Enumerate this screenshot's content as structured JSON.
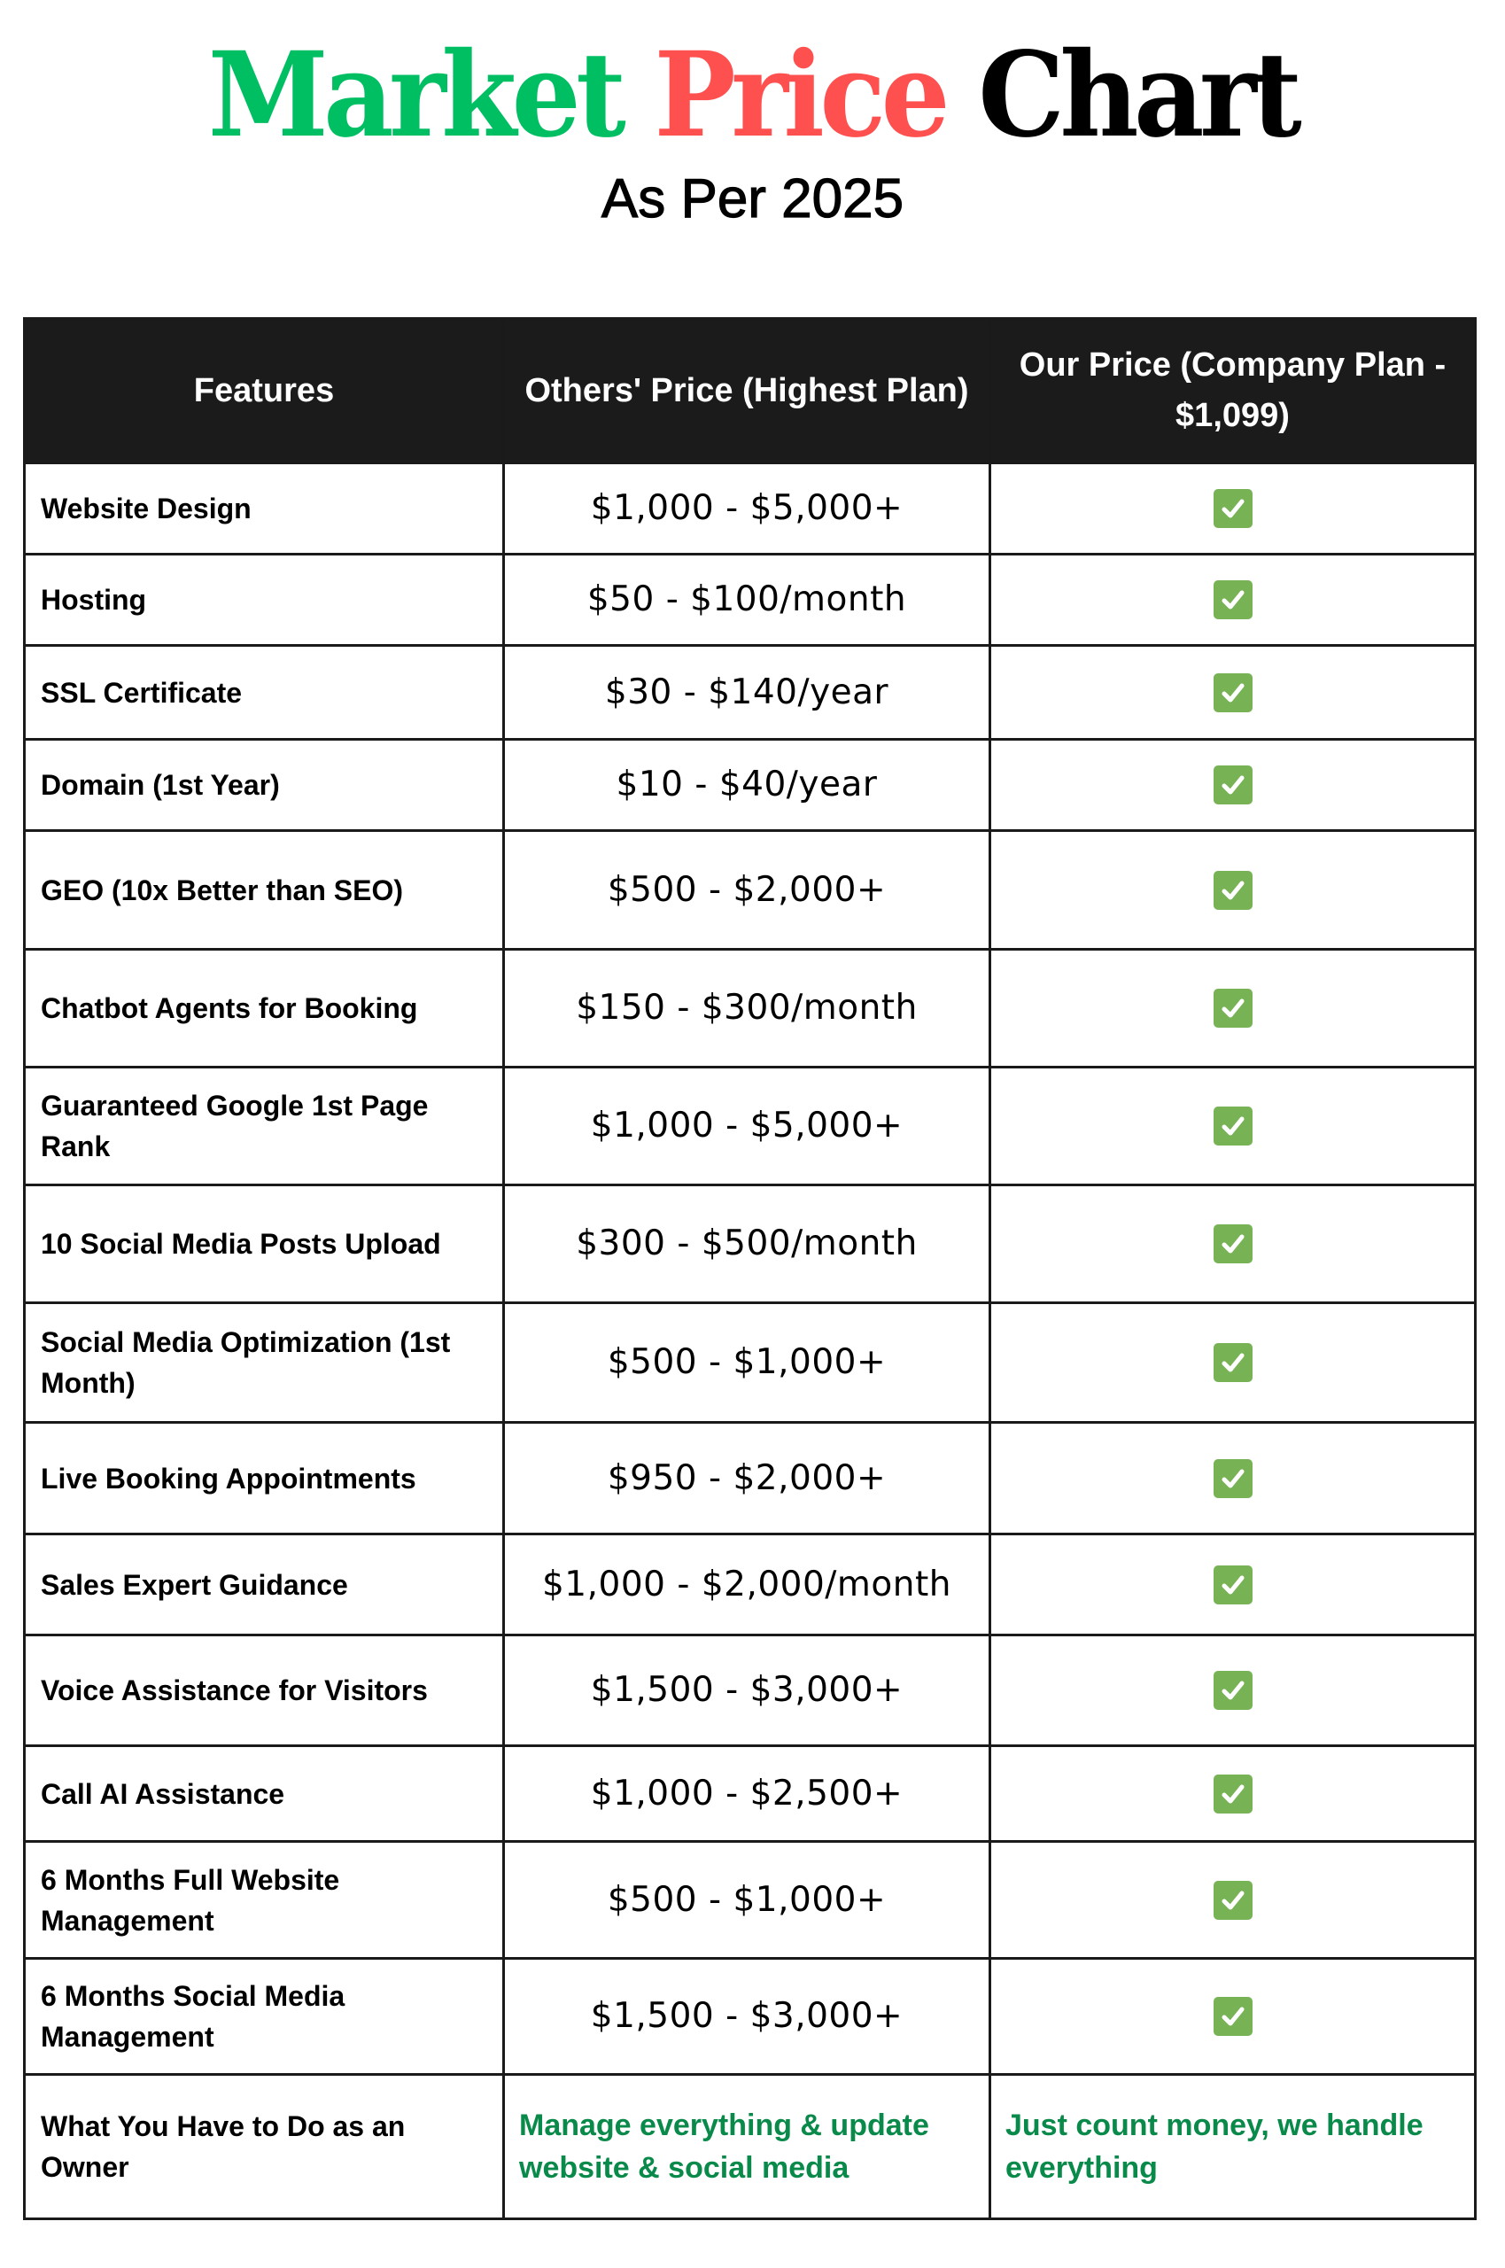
{
  "title": {
    "word1": "Market",
    "word2": "Price",
    "word3": "Chart",
    "subtitle": "As Per 2025",
    "colors": {
      "word1": "#00bf63",
      "word2": "#ff5050",
      "word3": "#000000"
    }
  },
  "table": {
    "headers": [
      "Features",
      "Others' Price (Highest Plan)",
      "Our Price (Company Plan - $1,099)"
    ],
    "check_icon": "check-box-icon",
    "check_color": "#77b255",
    "rows": [
      {
        "feature": "Website Design",
        "others_price": "$1,000 - $5,000+",
        "our_price": "included"
      },
      {
        "feature": "Hosting",
        "others_price": "$50 - $100/month",
        "our_price": "included"
      },
      {
        "feature": "SSL Certificate",
        "others_price": "$30 - $140/year",
        "our_price": "included"
      },
      {
        "feature": "Domain (1st Year)",
        "others_price": "$10 - $40/year",
        "our_price": "included"
      },
      {
        "feature": "GEO (10x Better than SEO)",
        "others_price": "$500 - $2,000+",
        "our_price": "included"
      },
      {
        "feature": "Chatbot Agents for Booking",
        "others_price": "$150 - $300/month",
        "our_price": "included"
      },
      {
        "feature": "Guaranteed Google 1st Page Rank",
        "others_price": "$1,000 - $5,000+",
        "our_price": "included"
      },
      {
        "feature": "10 Social Media Posts Upload",
        "others_price": "$300 - $500/month",
        "our_price": "included"
      },
      {
        "feature": "Social Media Optimization (1st Month)",
        "others_price": "$500 - $1,000+",
        "our_price": "included"
      },
      {
        "feature": "Live Booking Appointments",
        "others_price": "$950 - $2,000+",
        "our_price": "included"
      },
      {
        "feature": "Sales Expert Guidance",
        "others_price": "$1,000 - $2,000/month",
        "our_price": "included"
      },
      {
        "feature": "Voice Assistance for Visitors",
        "others_price": "$1,500 - $3,000+",
        "our_price": "included"
      },
      {
        "feature": "Call AI Assistance",
        "others_price": "$1,000 - $2,500+",
        "our_price": "included"
      },
      {
        "feature": "6 Months Full Website Management",
        "others_price": "$500 - $1,000+",
        "our_price": "included"
      },
      {
        "feature": "6 Months Social Media Management",
        "others_price": "$1,500 - $3,000+",
        "our_price": "included"
      }
    ],
    "owner_row": {
      "feature": "What You Have to Do as an Owner",
      "others": "Manage everything & update website & social media",
      "ours": "Just count money, we handle everything",
      "color": "#0a8a4a"
    }
  }
}
